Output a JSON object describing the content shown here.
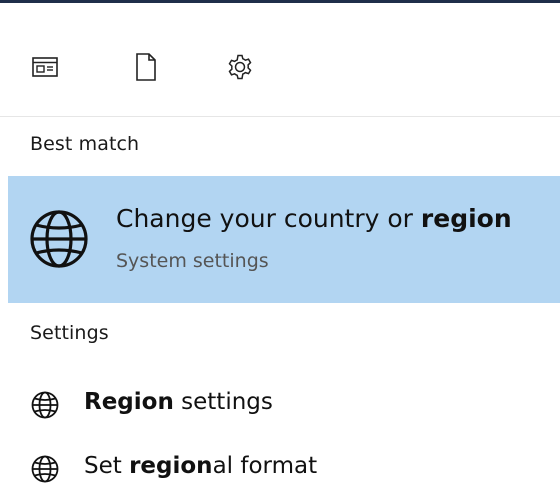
{
  "filters": [
    {
      "name": "apps",
      "icon": "app-window-icon"
    },
    {
      "name": "documents",
      "icon": "document-icon"
    },
    {
      "name": "settings",
      "icon": "gear-icon"
    }
  ],
  "sections": {
    "best_match_label": "Best match",
    "settings_label": "Settings"
  },
  "best_match": {
    "icon": "globe-icon",
    "title_prefix": "Change your country or ",
    "title_bold": "region",
    "subtitle": "System settings",
    "highlight_color": "#b2d5f2"
  },
  "settings_results": [
    {
      "icon": "globe-icon",
      "bold": "Region",
      "rest": " settings"
    },
    {
      "icon": "globe-icon",
      "pre": "Set ",
      "bold": "region",
      "rest": "al format"
    }
  ]
}
